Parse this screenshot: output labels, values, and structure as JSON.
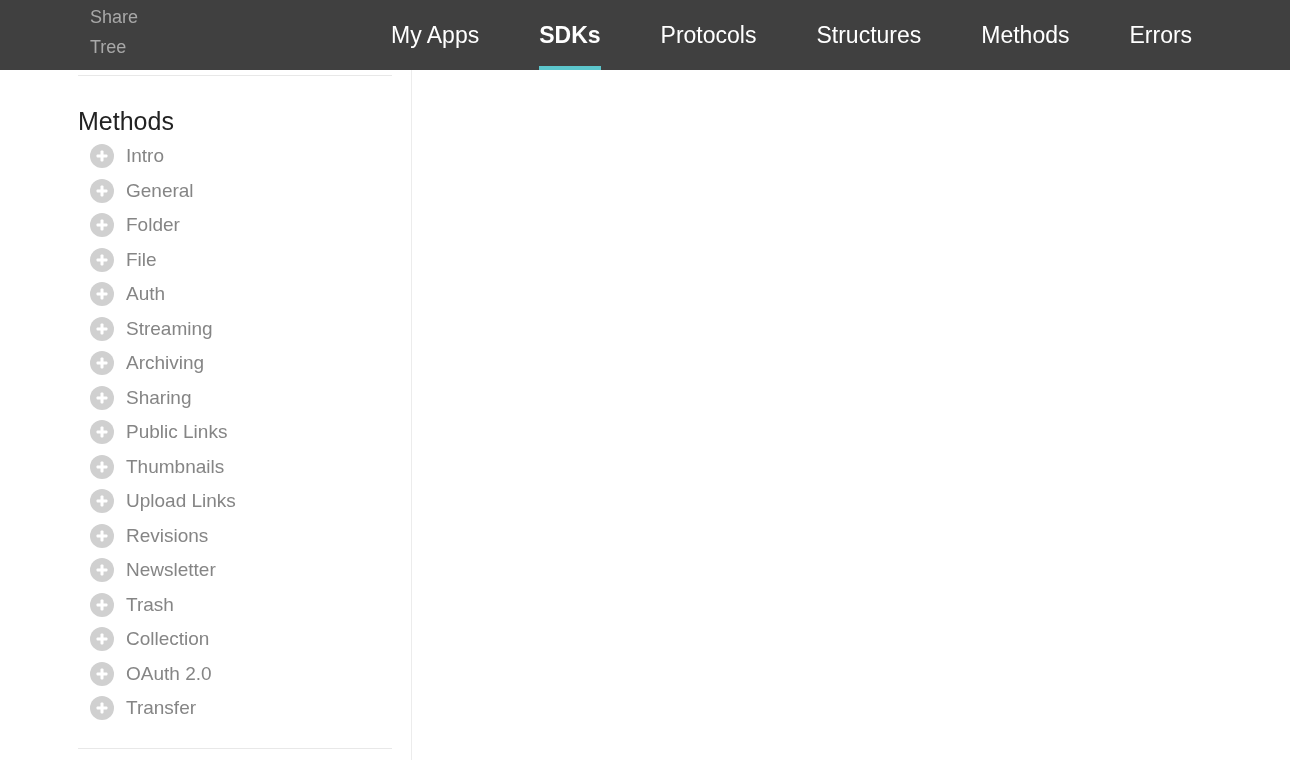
{
  "header": {
    "tabs": [
      {
        "label": "My Apps",
        "selected": false
      },
      {
        "label": "SDKs",
        "selected": true
      },
      {
        "label": "Protocols",
        "selected": false
      },
      {
        "label": "Structures",
        "selected": false
      },
      {
        "label": "Methods",
        "selected": false
      },
      {
        "label": "Errors",
        "selected": false
      }
    ]
  },
  "sidebar": {
    "items_above": [
      "Share",
      "Tree"
    ],
    "section_title": "Methods",
    "items": [
      {
        "label": "Intro",
        "expanded": false
      },
      {
        "label": "General",
        "expanded": false
      },
      {
        "label": "Folder",
        "expanded": false
      },
      {
        "label": "File",
        "expanded": false
      },
      {
        "label": "Auth",
        "expanded": false
      },
      {
        "label": "Streaming",
        "expanded": false
      },
      {
        "label": "Archiving",
        "expanded": false
      },
      {
        "label": "Sharing",
        "expanded": false
      },
      {
        "label": "Public Links",
        "expanded": false
      },
      {
        "label": "Thumbnails",
        "expanded": false
      },
      {
        "label": "Upload Links",
        "expanded": false
      },
      {
        "label": "Revisions",
        "expanded": false
      },
      {
        "label": "Newsletter",
        "expanded": false
      },
      {
        "label": "Trash",
        "expanded": false
      },
      {
        "label": "Collection",
        "expanded": false
      },
      {
        "label": "OAuth 2.0",
        "expanded": false
      },
      {
        "label": "Transfer",
        "expanded": false
      }
    ]
  }
}
